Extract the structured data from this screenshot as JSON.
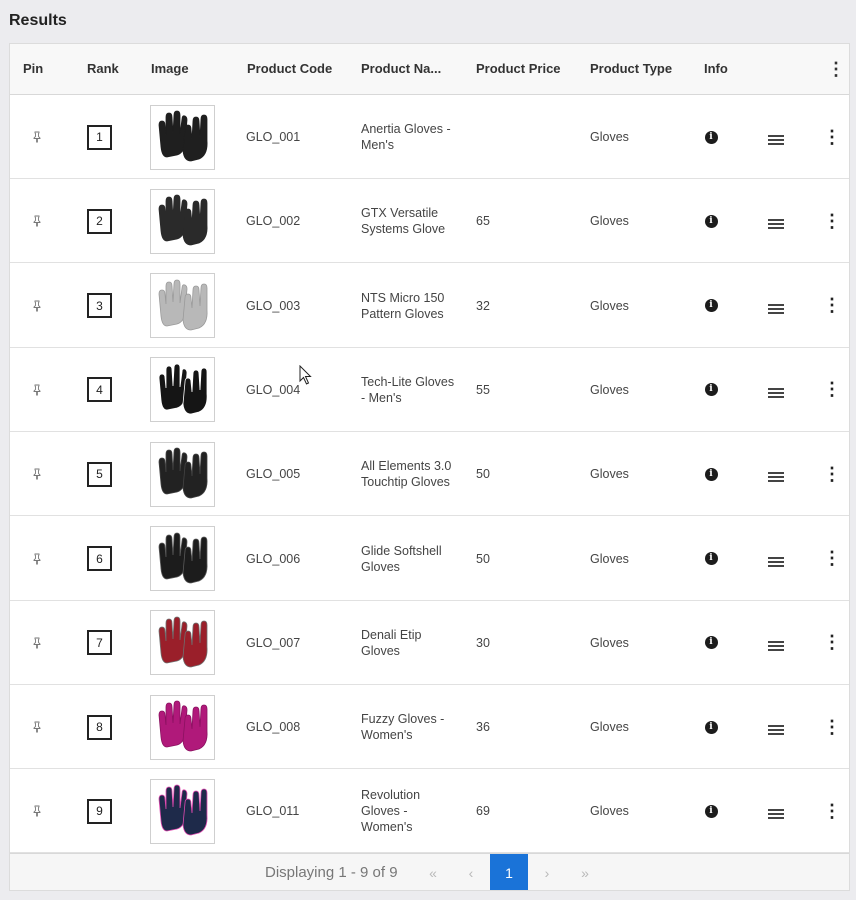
{
  "title": "Results",
  "columns": {
    "pin": "Pin",
    "rank": "Rank",
    "image": "Image",
    "product_code": "Product Code",
    "product_name": "Product Na...",
    "product_price": "Product Price",
    "product_type": "Product Type",
    "info": "Info"
  },
  "rows": [
    {
      "rank": "1",
      "code": "GLO_001",
      "name": "Anertia Gloves - Men's",
      "price": "",
      "type": "Gloves",
      "glove_color": "#1f1f1f",
      "accent": "#1f1f1f"
    },
    {
      "rank": "2",
      "code": "GLO_002",
      "name": "GTX Versatile Systems Glove",
      "price": "65",
      "type": "Gloves",
      "glove_color": "#2a2a2a",
      "accent": "#2a2a2a"
    },
    {
      "rank": "3",
      "code": "GLO_003",
      "name": "NTS Micro 150 Pattern Gloves",
      "price": "32",
      "type": "Gloves",
      "glove_color": "#b8b8b8",
      "accent": "#9a9a9a"
    },
    {
      "rank": "4",
      "code": "GLO_004",
      "name": "Tech-Lite Gloves - Men's",
      "price": "55",
      "type": "Gloves",
      "glove_color": "#151515",
      "accent": "#ffffff"
    },
    {
      "rank": "5",
      "code": "GLO_005",
      "name": "All Elements 3.0 Touchtip Gloves",
      "price": "50",
      "type": "Gloves",
      "glove_color": "#222222",
      "accent": "#444444"
    },
    {
      "rank": "6",
      "code": "GLO_006",
      "name": "Glide Softshell Gloves",
      "price": "50",
      "type": "Gloves",
      "glove_color": "#1c1c1c",
      "accent": "#5a5a5a"
    },
    {
      "rank": "7",
      "code": "GLO_007",
      "name": "Denali Etip Gloves",
      "price": "30",
      "type": "Gloves",
      "glove_color": "#9a1f2a",
      "accent": "#6f6f6f"
    },
    {
      "rank": "8",
      "code": "GLO_008",
      "name": "Fuzzy Gloves - Women's",
      "price": "36",
      "type": "Gloves",
      "glove_color": "#b0197a",
      "accent": "#8a1160"
    },
    {
      "rank": "9",
      "code": "GLO_011",
      "name": "Revolution Gloves - Women's",
      "price": "69",
      "type": "Gloves",
      "glove_color": "#1e2a4a",
      "accent": "#e04ab0"
    }
  ],
  "pager": {
    "status": "Displaying 1 - 9 of 9",
    "current_page": "1"
  },
  "colors": {
    "accent": "#1a73d8"
  }
}
